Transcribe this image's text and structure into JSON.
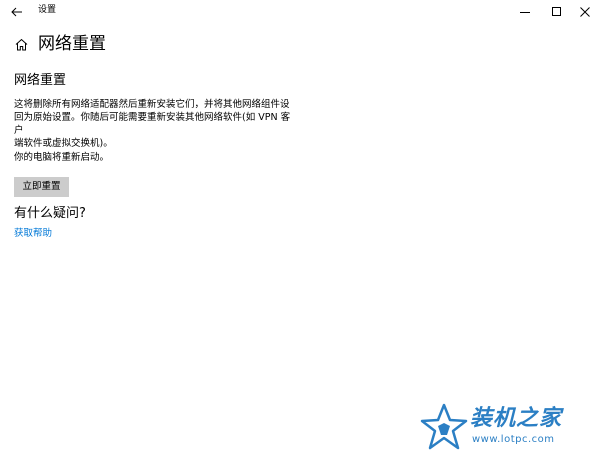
{
  "window": {
    "title": "设置"
  },
  "header": {
    "title": "网络重置"
  },
  "main": {
    "section_title": "网络重置",
    "description_line1": "这将删除所有网络适配器然后重新安装它们，并将其他网络组件设",
    "description_line2": "回为原始设置。你随后可能需要重新安装其他网络软件(如 VPN 客户",
    "description_line3": "端软件或虚拟交换机)。",
    "restart_note": "你的电脑将重新启动。",
    "reset_button_label": "立即重置",
    "question_title": "有什么疑问?",
    "help_link": "获取帮助"
  },
  "watermark": {
    "name": "装机之家",
    "url": "www.lotpc.com"
  },
  "icons": {
    "back": "back-arrow-icon",
    "home": "home-icon",
    "minimize": "minimize-icon",
    "maximize": "maximize-icon",
    "close": "close-icon"
  },
  "colors": {
    "link": "#0078d7",
    "button_bg": "#cccccc",
    "watermark": "#2b7fc4"
  }
}
